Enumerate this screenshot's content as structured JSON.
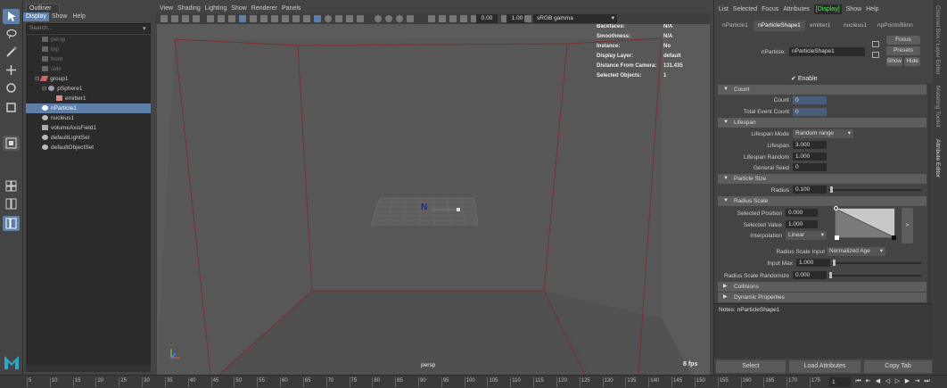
{
  "outliner": {
    "title": "Outliner",
    "menu": [
      "Display",
      "Show",
      "Help"
    ],
    "search_placeholder": "Search...",
    "items": [
      {
        "label": "persp",
        "dim": true
      },
      {
        "label": "top",
        "dim": true
      },
      {
        "label": "front",
        "dim": true
      },
      {
        "label": "side",
        "dim": true
      },
      {
        "label": "group1"
      },
      {
        "label": "pSphere1"
      },
      {
        "label": "emitter1"
      },
      {
        "label": "nParticle1",
        "selected": true
      },
      {
        "label": "nucleus1"
      },
      {
        "label": "volumeAxisField1"
      },
      {
        "label": "defaultLightSet"
      },
      {
        "label": "defaultObjectSet"
      }
    ]
  },
  "viewport": {
    "menu": [
      "View",
      "Shading",
      "Lighting",
      "Show",
      "Renderer",
      "Panels"
    ],
    "exposure": "0.00",
    "gamma": "1.00",
    "color_space": "sRGB gamma",
    "camera_label": "persp",
    "fps": "8 fps",
    "hud": [
      {
        "key": "Backfaces:",
        "value": "N/A"
      },
      {
        "key": "Smoothness:",
        "value": "N/A"
      },
      {
        "key": "Instance:",
        "value": "No"
      },
      {
        "key": "Display Layer:",
        "value": "default"
      },
      {
        "key": "Distance From Camera:",
        "value": "131.435"
      },
      {
        "key": "Selected Objects:",
        "value": "1"
      }
    ],
    "nucleus_label": "N"
  },
  "attribute_editor": {
    "menu": [
      "List",
      "Selected",
      "Focus",
      "Attributes",
      "Show",
      "Help"
    ],
    "menu_highlight": "[Display]",
    "tabs": [
      "nParticle1",
      "nParticleShape1",
      "emitter1",
      "nucleus1",
      "npPointsBlinn"
    ],
    "active_tab": 1,
    "node_label": "nParticle:",
    "node_value": "nParticleShape1",
    "buttons": {
      "focus": "Focus",
      "presets": "Presets",
      "show": "Show",
      "hide": "Hide"
    },
    "enable_label": "Enable",
    "sections": {
      "count": "Count",
      "lifespan": "Lifespan",
      "particle_size": "Particle Size",
      "radius_scale": "Radius Scale",
      "collisions": "Collisions",
      "dynamic_properties": "Dynamic Properties"
    },
    "count": {
      "count_label": "Count",
      "count_value": "0",
      "total_label": "Total Event Count",
      "total_value": "0"
    },
    "lifespan": {
      "mode_label": "Lifespan Mode",
      "mode_value": "Random range",
      "lifespan_label": "Lifespan",
      "lifespan_value": "3.000",
      "random_label": "Lifespan Random",
      "random_value": "1.000",
      "seed_label": "General Seed",
      "seed_value": "0"
    },
    "particle_size": {
      "radius_label": "Radius",
      "radius_value": "0.100",
      "radius_fraction": 0.1
    },
    "radius_scale": {
      "selpos_label": "Selected Position",
      "selpos_value": "0.000",
      "selval_label": "Selected Value",
      "selval_value": "1.000",
      "interp_label": "Interpolation",
      "interp_value": "Linear",
      "input_label": "Radius Scale Input",
      "input_value": "Normalized Age",
      "inmax_label": "Input Max",
      "inmax_value": "1.000",
      "randomize_label": "Radius Scale Randomize",
      "randomize_value": "0.000",
      "expand_glyph": ">"
    },
    "notes_label": "Notes:",
    "notes_value": "nParticleShape1",
    "bottom_buttons": [
      "Select",
      "Load Attributes",
      "Copy Tab"
    ]
  },
  "side_tabs": [
    "Channel Box / Layer Editor",
    "Modeling Toolkit",
    "Attribute Editor"
  ],
  "timeline": {
    "ticks": [
      5,
      10,
      15,
      20,
      25,
      30,
      35,
      40,
      45,
      50,
      55,
      60,
      65,
      70,
      75,
      80,
      85,
      90,
      95,
      100,
      105,
      110,
      115,
      120,
      125,
      130,
      135,
      140,
      145,
      150,
      155,
      160,
      165,
      170,
      175
    ],
    "end_frame": "1"
  },
  "logo": "M"
}
